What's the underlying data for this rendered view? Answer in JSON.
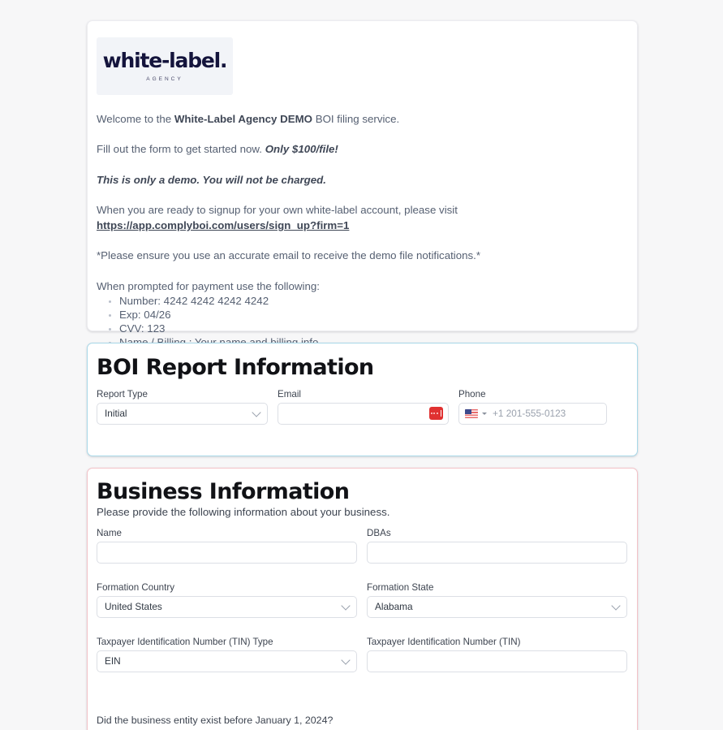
{
  "intro": {
    "logo": {
      "wordmark": "white-label.",
      "subtext": "AGENCY"
    },
    "welcome_pre": "Welcome to the ",
    "welcome_bold": "White-Label Agency DEMO",
    "welcome_post": " BOI filing service.",
    "fillout_pre": "Fill out the form to get started now. ",
    "fillout_bold": "Only $100/file!",
    "demo_notice": "This is only a demo. You will not be charged.",
    "signup_text": "When you are ready to signup for your own white-label account, please visit",
    "signup_url": "https://app.complyboi.com/users/sign_up?firm=1",
    "email_notice": "*Please ensure you use an accurate email to receive the demo file notifications.*",
    "payment_intro": "When prompted for payment use the following:",
    "payment_items": [
      "Number: 4242 4242 4242 4242",
      "Exp: 04/26",
      "CVV: 123",
      "Name / Billing : Your name and billing info"
    ]
  },
  "boi_section": {
    "title": "BOI Report Information",
    "report_type": {
      "label": "Report Type",
      "value": "Initial"
    },
    "email": {
      "label": "Email",
      "value": ""
    },
    "phone": {
      "label": "Phone",
      "placeholder": "+1 201-555-0123",
      "country": "US"
    }
  },
  "business_section": {
    "title": "Business Information",
    "subtitle": "Please provide the following information about your business.",
    "name": {
      "label": "Name",
      "value": ""
    },
    "dbas": {
      "label": "DBAs",
      "value": ""
    },
    "formation_country": {
      "label": "Formation Country",
      "value": "United States"
    },
    "formation_state": {
      "label": "Formation State",
      "value": "Alabama"
    },
    "tin_type": {
      "label": "Taxpayer Identification Number (TIN) Type",
      "value": "EIN"
    },
    "tin": {
      "label": "Taxpayer Identification Number (TIN)",
      "value": ""
    },
    "existence_question": "Did the business entity exist before January 1, 2024?"
  },
  "colors": {
    "page_background": "#f7f7f8",
    "boi_card_border": "#a8d8e8",
    "business_card_border": "#f3c2c8",
    "logo_navy": "#14143c",
    "password_icon_red": "#e03131"
  }
}
